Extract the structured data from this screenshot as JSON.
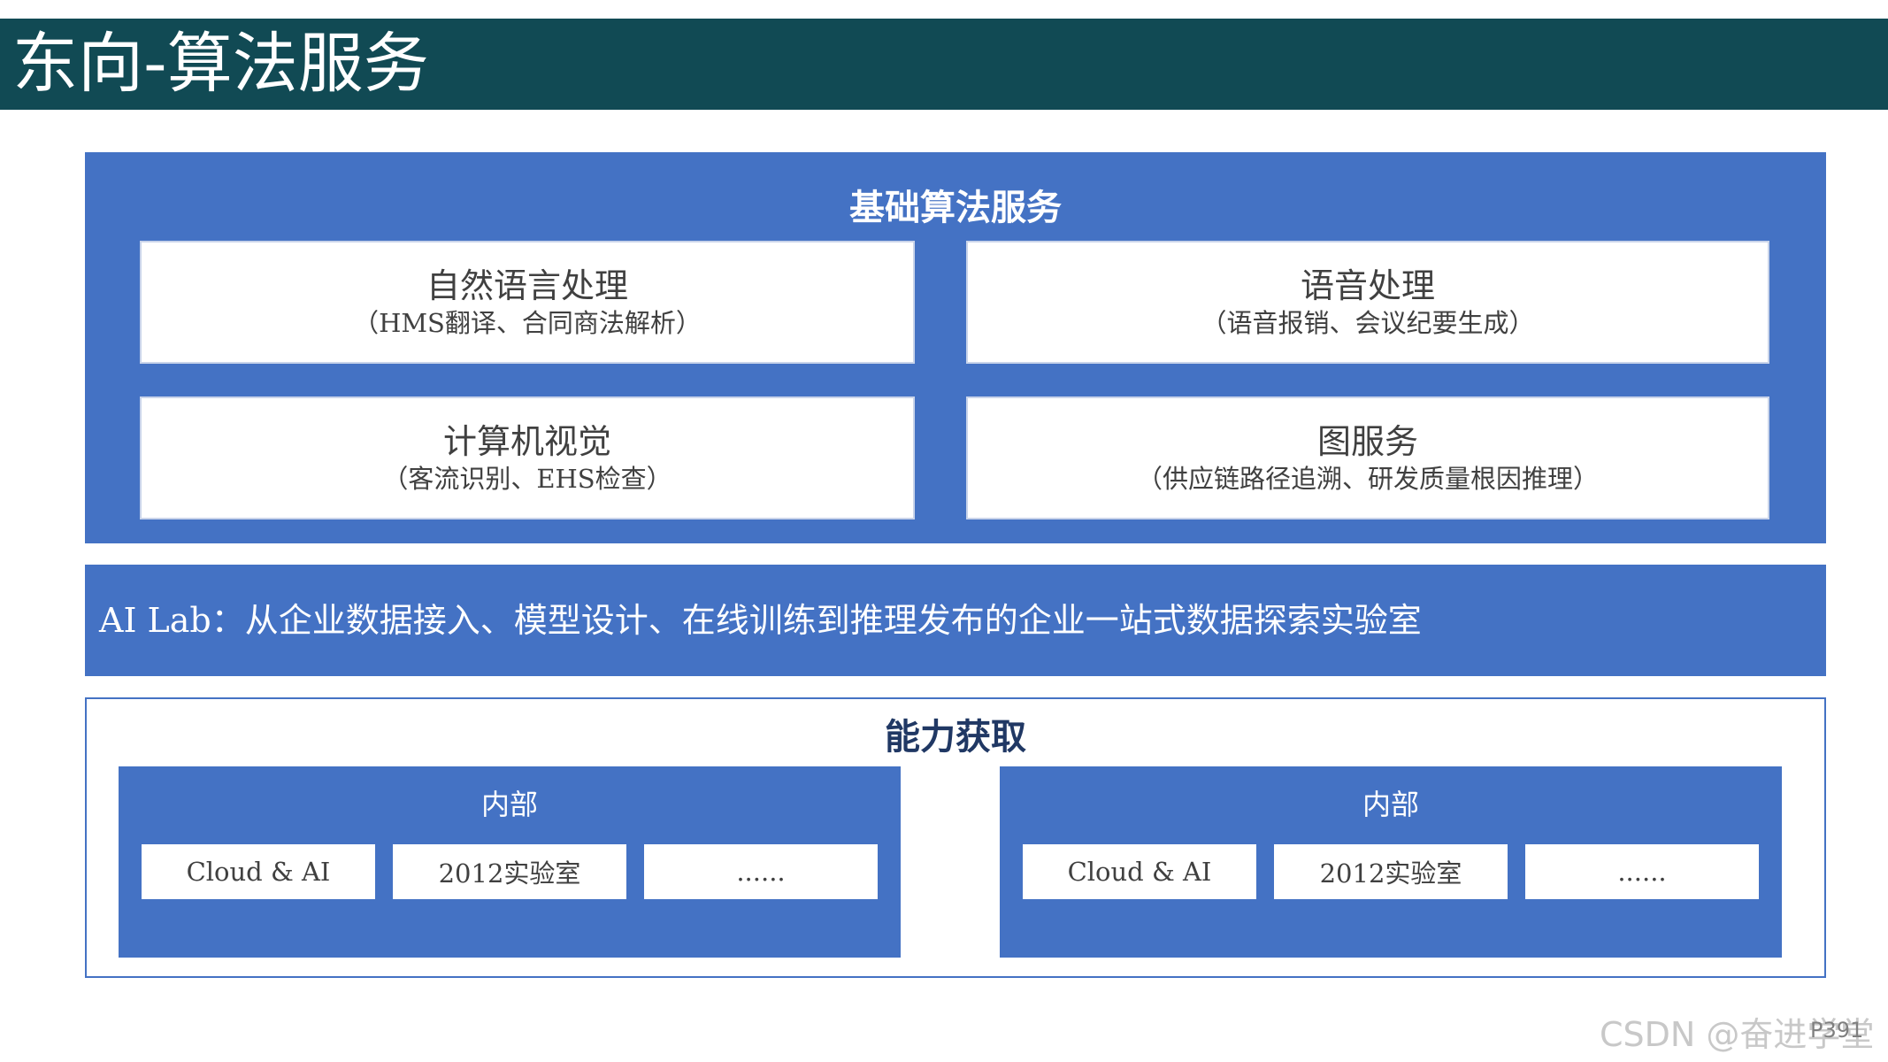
{
  "header": {
    "title": "东向-算法服务"
  },
  "basic_services": {
    "title": "基础算法服务",
    "cards": [
      {
        "title": "自然语言处理",
        "subtitle": "（HMS翻译、合同商法解析）"
      },
      {
        "title": "语音处理",
        "subtitle": "（语音报销、会议纪要生成）"
      },
      {
        "title": "计算机视觉",
        "subtitle": "（客流识别、EHS检查）"
      },
      {
        "title": "图服务",
        "subtitle": "（供应链路径追溯、研发质量根因推理）"
      }
    ]
  },
  "ai_lab": {
    "text": "AI Lab：从企业数据接入、模型设计、在线训练到推理发布的企业一站式数据探索实验室"
  },
  "capability": {
    "title": "能力获取",
    "groups": [
      {
        "label": "内部",
        "items": [
          "Cloud & AI",
          "2012实验室",
          "......"
        ]
      },
      {
        "label": "内部",
        "items": [
          "Cloud & AI",
          "2012实验室",
          "......"
        ]
      }
    ]
  },
  "footer": {
    "watermark": "CSDN @奋进学堂",
    "page_number": "P391"
  },
  "colors": {
    "title_bar": "#114a54",
    "panel_blue": "#4472c4",
    "dark_title": "#203864"
  }
}
